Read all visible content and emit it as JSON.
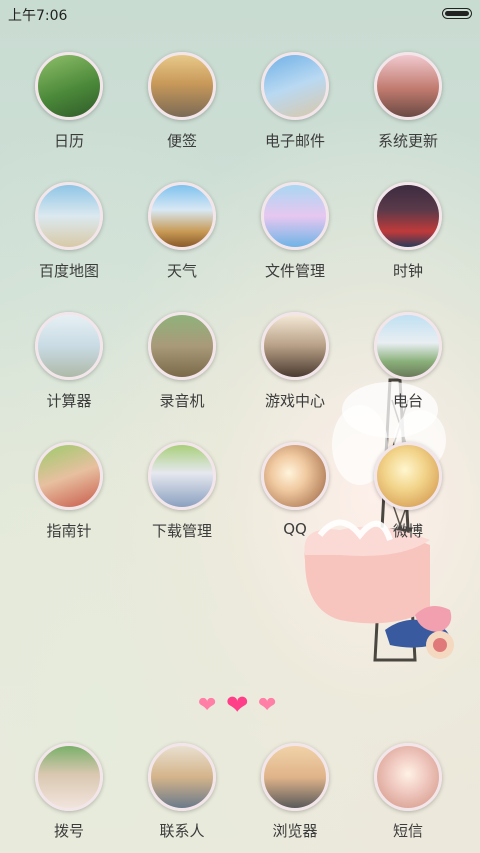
{
  "status_bar": {
    "time": "上午7:06"
  },
  "apps": [
    {
      "label": "日历",
      "bg": "linear-gradient(160deg,#8fbf6a 0%,#4c8a3a 55%,#2f5a2a 100%)"
    },
    {
      "label": "便签",
      "bg": "linear-gradient(180deg,#e7c98a 0%,#c99a5a 45%,#7b6a55 100%)"
    },
    {
      "label": "电子邮件",
      "bg": "linear-gradient(160deg,#6fb0e6 0%,#b9d9f2 50%,#d9c7a8 100%)"
    },
    {
      "label": "系统更新",
      "bg": "linear-gradient(180deg,#f1c9cf 0%,#c07a6e 55%,#6a4a44 100%)"
    },
    {
      "label": "百度地图",
      "bg": "linear-gradient(180deg,#8fc5e6 0%,#dbe9ef 50%,#d8c9a6 100%)"
    },
    {
      "label": "天气",
      "bg": "linear-gradient(180deg,#7fc2ee 0%,#d8e8f4 40%,#c89a55 75%,#8a5a2a 100%)"
    },
    {
      "label": "文件管理",
      "bg": "linear-gradient(180deg,#a9d7f2 0%,#e7c7f0 50%,#6fb4e6 100%)"
    },
    {
      "label": "时钟",
      "bg": "linear-gradient(180deg,#3c2b40 0%,#5a3a4a 40%,#c03a3a 75%,#2a3a5a 100%)"
    },
    {
      "label": "计算器",
      "bg": "linear-gradient(180deg,#e6f0f4 0%,#c9dbe4 50%,#aeb9a8 100%)"
    },
    {
      "label": "录音机",
      "bg": "linear-gradient(180deg,#8fb27a 0%,#a99a7a 50%,#7a6a4a 100%)"
    },
    {
      "label": "游戏中心",
      "bg": "linear-gradient(180deg,#f4e9d6 0%,#b79f86 50%,#4a3a30 100%)"
    },
    {
      "label": "电台",
      "bg": "linear-gradient(180deg,#bfe0f2 0%,#e9eef2 45%,#8ab07a 75%,#6a7a5a 100%)"
    },
    {
      "label": "指南针",
      "bg": "linear-gradient(160deg,#9ccb6a 0%,#e7c0a0 50%,#c85a4a 100%)"
    },
    {
      "label": "下载管理",
      "bg": "linear-gradient(180deg,#a9cf7a 0%,#e6e8ef 45%,#8aa0c0 100%)"
    },
    {
      "label": "QQ",
      "bg": "radial-gradient(circle at 40% 45%,#fff4dc 0%,#f0c9a0 35%,#c0906a 70%,#7a5a4a 100%)"
    },
    {
      "label": "微博",
      "bg": "radial-gradient(circle at 45% 40%,#fff6cf 0%,#f2d48a 40%,#d9a35a 80%,#b08040 100%)"
    }
  ],
  "page_indicator": {
    "count": 3,
    "active": 1
  },
  "dock": [
    {
      "label": "拨号",
      "bg": "linear-gradient(180deg,#7ab06a 0%,#d9c7b0 45%,#f1e4dc 100%)"
    },
    {
      "label": "联系人",
      "bg": "linear-gradient(180deg,#e9e0d0 0%,#d4b48a 50%,#6a7a8a 100%)"
    },
    {
      "label": "浏览器",
      "bg": "linear-gradient(180deg,#f1d2a8 0%,#e0b48a 50%,#5a5a5a 100%)"
    },
    {
      "label": "短信",
      "bg": "radial-gradient(circle at 50% 45%,#fff2e6 0%,#f0c9c0 40%,#d09080 100%)"
    }
  ]
}
